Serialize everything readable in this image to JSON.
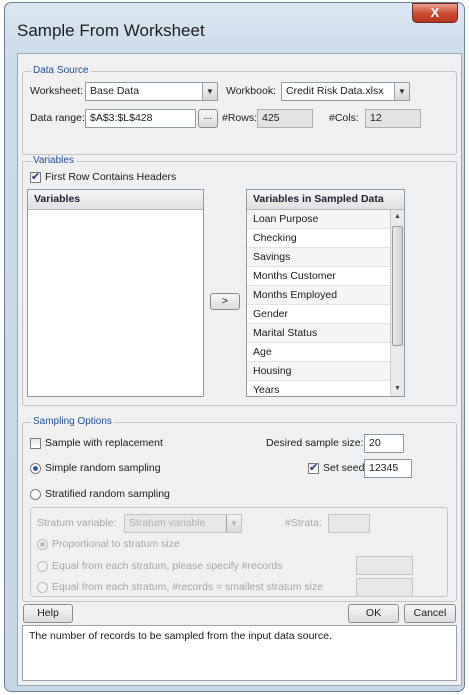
{
  "window": {
    "title": "Sample From Worksheet",
    "close_glyph": "X"
  },
  "data_source": {
    "legend": "Data Source",
    "worksheet_label": "Worksheet:",
    "worksheet_value": "Base Data",
    "workbook_label": "Workbook:",
    "workbook_value": "Credit Risk Data.xlsx",
    "range_label": "Data range:",
    "range_value": "$A$3:$L$428",
    "range_button": "...",
    "rows_label": "#Rows:",
    "rows_value": "425",
    "cols_label": "#Cols:",
    "cols_value": "12"
  },
  "variables": {
    "legend": "Variables",
    "headers_checkbox_label": "First Row Contains Headers",
    "headers_checked": true,
    "left_header": "Variables",
    "left_items": [],
    "move_button": ">",
    "right_header": "Variables in Sampled Data",
    "right_items": [
      "Loan Purpose",
      "Checking",
      "Savings",
      "Months Customer",
      "Months Employed",
      "Gender",
      "Marital Status",
      "Age",
      "Housing",
      "Years"
    ]
  },
  "sampling": {
    "legend": "Sampling Options",
    "replacement_label": "Sample with replacement",
    "replacement_checked": false,
    "desired_size_label": "Desired sample size:",
    "desired_size_value": "20",
    "simple_label": "Simple random sampling",
    "simple_selected": true,
    "set_seed_label": "Set seed",
    "set_seed_checked": true,
    "seed_value": "12345",
    "stratified_label": "Stratified random sampling",
    "stratified_selected": false,
    "stratum_var_label": "Stratum variable:",
    "stratum_var_placeholder": "Stratum variable",
    "strata_label": "#Strata:",
    "proportional_label": "Proportional to stratum size",
    "equal_specify_label": "Equal from each stratum, please specify #records",
    "equal_smallest_label": "Equal from each stratum, #records = smallest stratum size"
  },
  "buttons": {
    "help": "Help",
    "ok": "OK",
    "cancel": "Cancel"
  },
  "status_text": "The number of records to be sampled from the input data source."
}
